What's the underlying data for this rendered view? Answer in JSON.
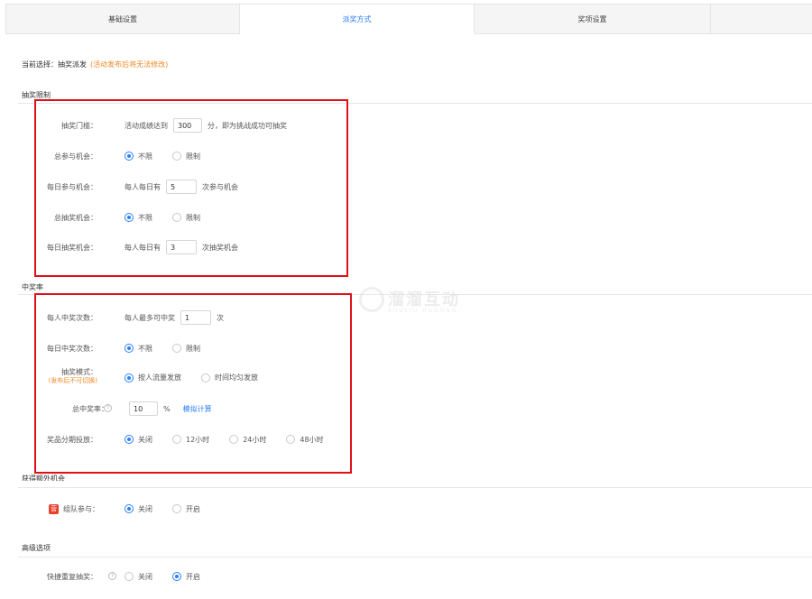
{
  "tabs": [
    {
      "label": "基础设置"
    },
    {
      "label": "派奖方式"
    },
    {
      "label": "奖项设置"
    },
    {
      "label": ""
    }
  ],
  "current": {
    "label": "当前选择：抽奖派发",
    "hint": "(活动发布后将无法修改)"
  },
  "lottery_limit": {
    "title": "抽奖限制",
    "threshold": {
      "label": "抽奖门槛：",
      "before": "活动成绩达到",
      "value": "300",
      "after": "分，即为挑战成功可抽奖"
    },
    "total_chance": {
      "label": "总参与机会：",
      "opt1": "不限",
      "opt2": "限制"
    },
    "daily_chance": {
      "label": "每日参与机会：",
      "before": "每人每日有",
      "value": "5",
      "after": "次参与机会"
    },
    "total_draw": {
      "label": "总抽奖机会：",
      "opt1": "不限",
      "opt2": "限制"
    },
    "daily_draw": {
      "label": "每日抽奖机会：",
      "before": "每人每日有",
      "value": "3",
      "after": "次抽奖机会"
    }
  },
  "win_rate": {
    "title": "中奖率",
    "per_person": {
      "label": "每人中奖次数：",
      "before": "每人最多可中奖",
      "value": "1",
      "after": "次"
    },
    "daily_win": {
      "label": "每日中奖次数：",
      "opt1": "不限",
      "opt2": "限制"
    },
    "mode": {
      "label": "抽奖模式：",
      "sub": "(发布后不可切换)",
      "opt1": "按人流量发放",
      "opt2": "时间均匀发放"
    },
    "total_rate": {
      "label": "总中奖率：",
      "value": "10",
      "unit": "%",
      "link": "模拟计算"
    },
    "staging": {
      "label": "奖品分期投放：",
      "opt1": "关闭",
      "opt2": "12小时",
      "opt3": "24小时",
      "opt4": "48小时"
    }
  },
  "extra": {
    "title": "获得额外机会",
    "team": {
      "badge": "营",
      "label": "组队参与：",
      "opt1": "关闭",
      "opt2": "开启"
    }
  },
  "advanced": {
    "title": "高级选项",
    "quick_redraw": {
      "label": "快捷重复抽奖：",
      "opt1": "关闭",
      "opt2": "开启"
    }
  },
  "watermark": {
    "text": "溜溜互动",
    "sub": "SHULIU HUDONG"
  },
  "colors": {
    "accent": "#2d7ff9",
    "warning": "#f08a24",
    "highlight_box": "#e0101a"
  }
}
